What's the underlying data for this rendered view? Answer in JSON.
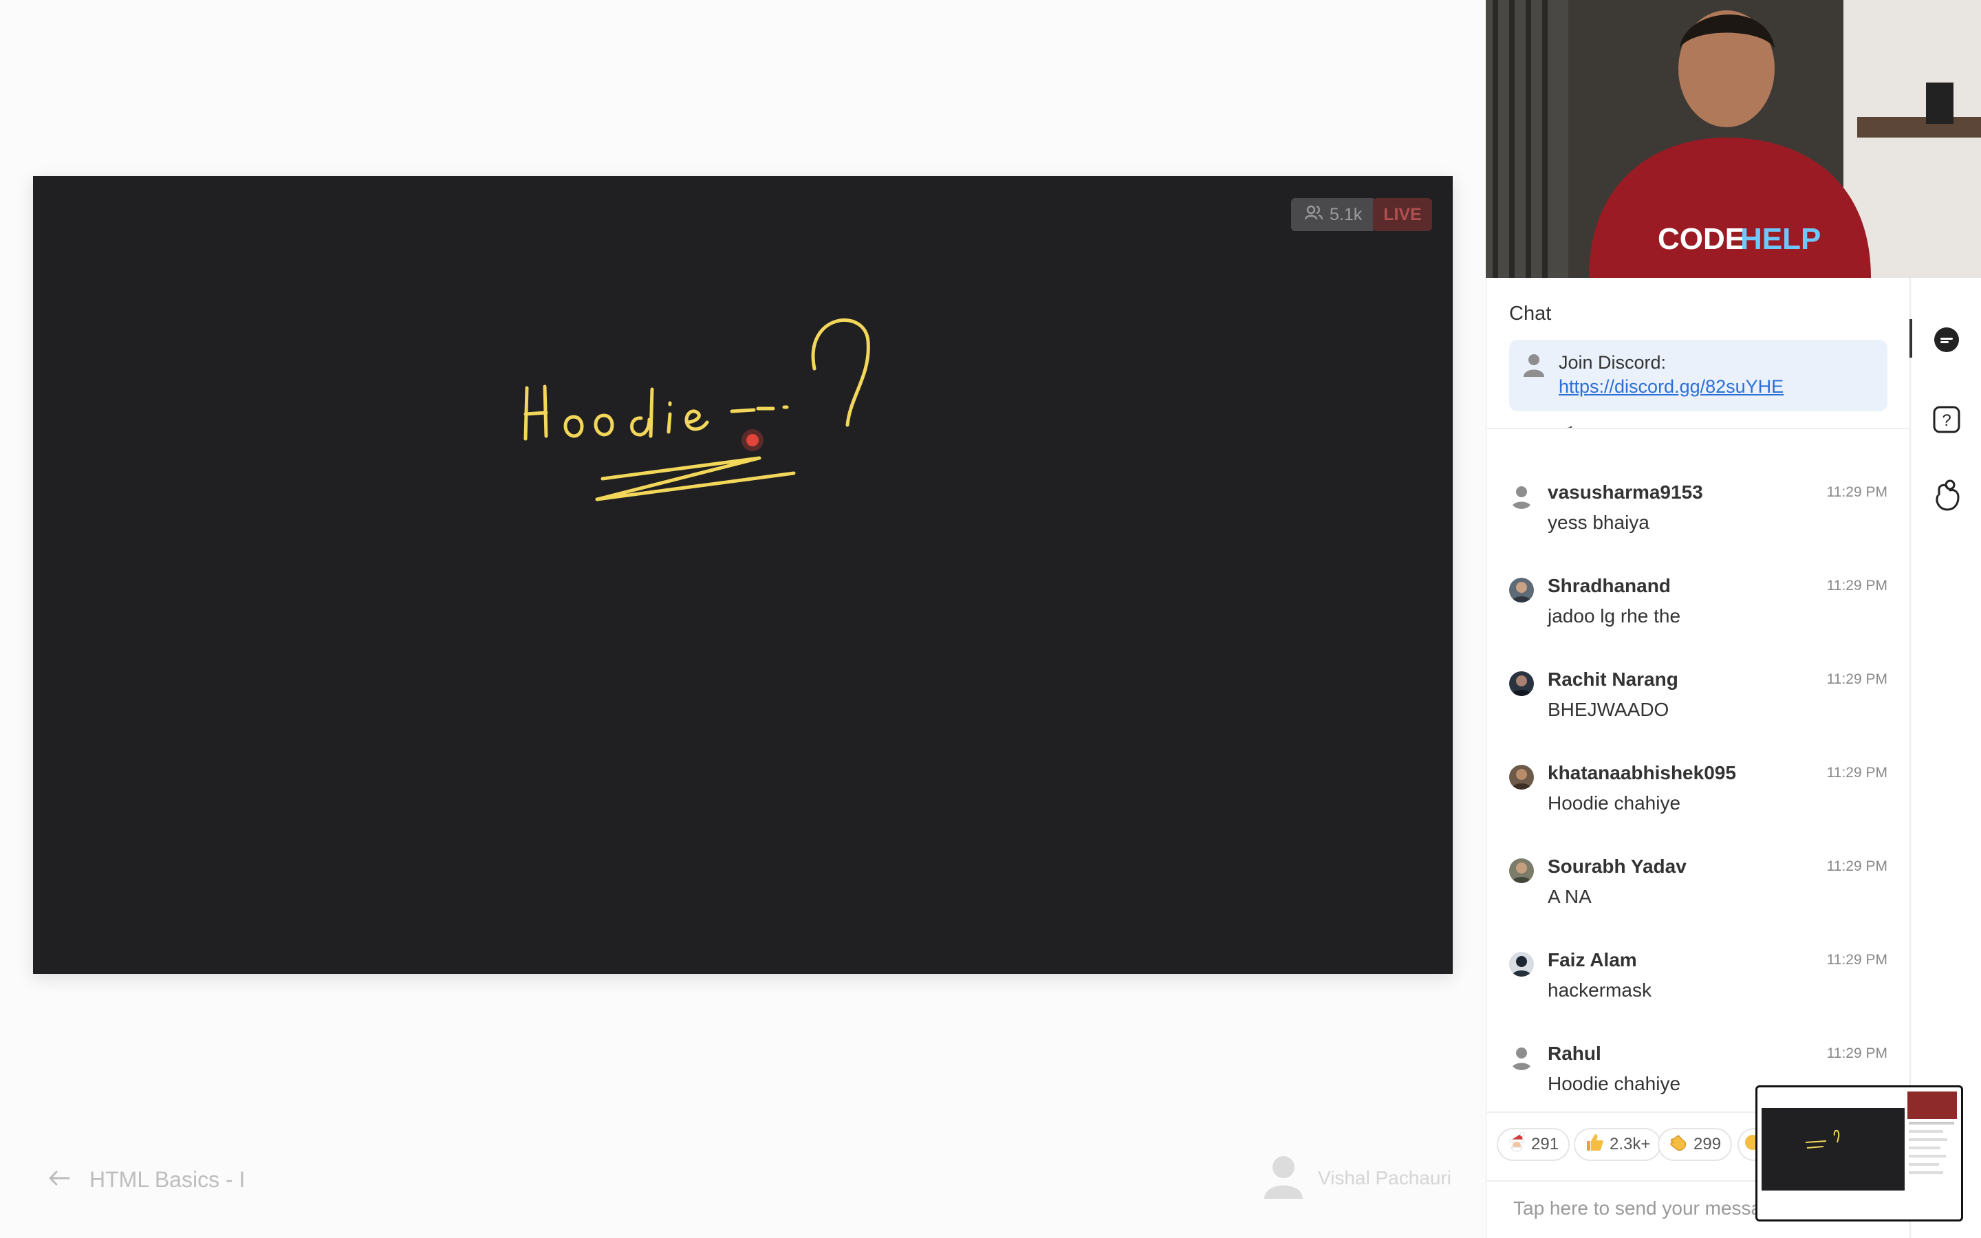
{
  "board": {
    "viewers": "5.1k",
    "live_label": "LIVE",
    "handwriting": "Hoodie --?"
  },
  "footer": {
    "back_icon": "arrow-left-icon",
    "lesson_title": "HTML Basics - I",
    "instructor": "Vishal Pachauri"
  },
  "chat": {
    "title": "Chat",
    "pinned": {
      "text": "Join Discord:",
      "link": "https://discord.gg/82suYHE"
    },
    "cut_message": "Jay ho",
    "messages": [
      {
        "name": "vasusharma9153",
        "time": "11:29 PM",
        "text": "yess bhaiya",
        "avatar": "default"
      },
      {
        "name": "Shradhanand",
        "time": "11:29 PM",
        "text": "jadoo lg rhe the",
        "avatar": "photo"
      },
      {
        "name": "Rachit Narang",
        "time": "11:29 PM",
        "text": "BHEJWAADO",
        "avatar": "photo"
      },
      {
        "name": "khatanaabhishek095",
        "time": "11:29 PM",
        "text": "Hoodie chahiye",
        "avatar": "photo"
      },
      {
        "name": "Sourabh Yadav",
        "time": "11:29 PM",
        "text": "A NA",
        "avatar": "photo"
      },
      {
        "name": "Faiz Alam",
        "time": "11:29 PM",
        "text": "hackermask",
        "avatar": "photo"
      },
      {
        "name": "Rahul",
        "time": "11:29 PM",
        "text": "Hoodie chahiye",
        "avatar": "default"
      }
    ],
    "reactions": [
      {
        "icon": "santa-icon",
        "count": "291"
      },
      {
        "icon": "thumbs-up-icon",
        "count": "2.3k+"
      },
      {
        "icon": "clap-icon",
        "count": "299"
      }
    ],
    "input_placeholder": "Tap here to send your message"
  },
  "sidebar": {
    "icons": [
      "chat-icon",
      "question-icon",
      "raise-hand-icon"
    ]
  },
  "colors": {
    "board_bg": "#202022",
    "ink": "#f2d75a",
    "link": "#2b6fd6",
    "live_red": "#5b2a2a"
  }
}
